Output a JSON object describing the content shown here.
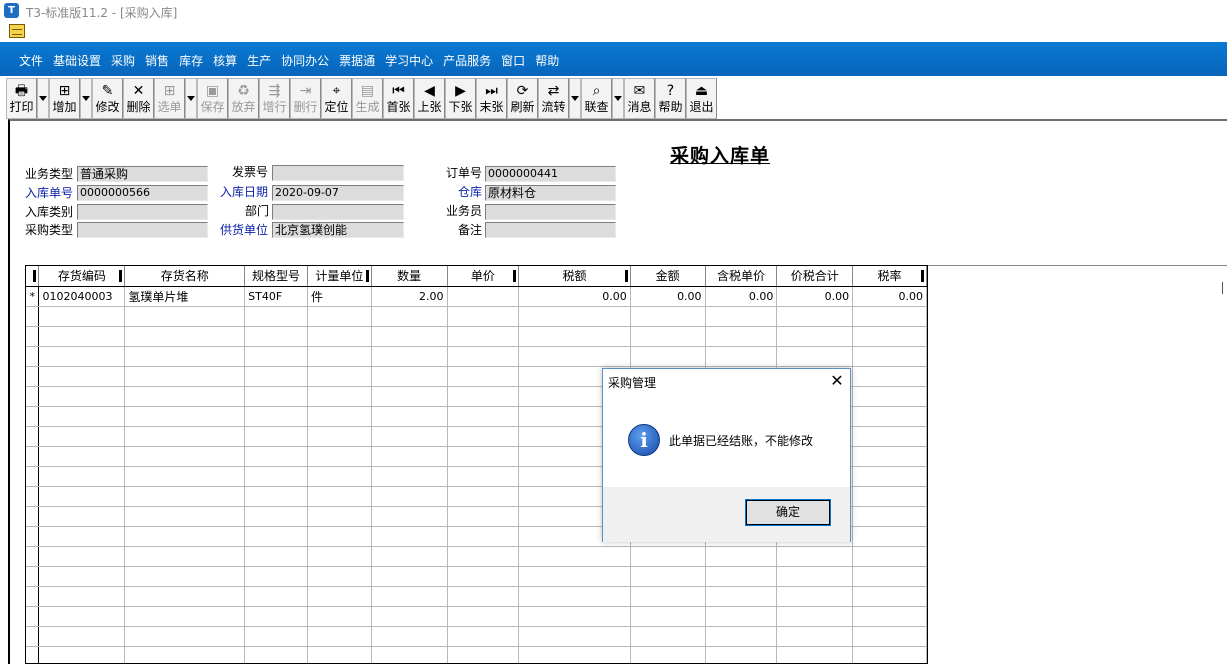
{
  "window": {
    "title": "T3-标准版11.2 - [采购入库]"
  },
  "menu": [
    "文件",
    "基础设置",
    "采购",
    "销售",
    "库存",
    "核算",
    "生产",
    "协同办公",
    "票据通",
    "学习中心",
    "产品服务",
    "窗口",
    "帮助"
  ],
  "toolbar": [
    {
      "label": "打印",
      "icon": "print-icon",
      "glyph": "🖶",
      "enabled": true,
      "dropdown": true
    },
    {
      "label": "增加",
      "icon": "add-icon",
      "glyph": "⊞",
      "enabled": true,
      "dropdown": true
    },
    {
      "label": "修改",
      "icon": "edit-icon",
      "glyph": "✎",
      "enabled": true,
      "dropdown": false
    },
    {
      "label": "删除",
      "icon": "delete-icon",
      "glyph": "✕",
      "enabled": true,
      "dropdown": false
    },
    {
      "label": "选单",
      "icon": "select-doc-icon",
      "glyph": "⊞",
      "enabled": false,
      "dropdown": true
    },
    {
      "label": "保存",
      "icon": "save-icon",
      "glyph": "▣",
      "enabled": false,
      "dropdown": false
    },
    {
      "label": "放弃",
      "icon": "discard-icon",
      "glyph": "♻",
      "enabled": false,
      "dropdown": false
    },
    {
      "label": "增行",
      "icon": "add-row-icon",
      "glyph": "⇶",
      "enabled": false,
      "dropdown": false
    },
    {
      "label": "删行",
      "icon": "delete-row-icon",
      "glyph": "⇥",
      "enabled": false,
      "dropdown": false
    },
    {
      "label": "定位",
      "icon": "locate-icon",
      "glyph": "⌖",
      "enabled": true,
      "dropdown": false
    },
    {
      "label": "生成",
      "icon": "generate-icon",
      "glyph": "▤",
      "enabled": false,
      "dropdown": false
    },
    {
      "label": "首张",
      "icon": "first-record-icon",
      "glyph": "⏮",
      "enabled": true,
      "dropdown": false
    },
    {
      "label": "上张",
      "icon": "previous-record-icon",
      "glyph": "◀",
      "enabled": true,
      "dropdown": false
    },
    {
      "label": "下张",
      "icon": "next-record-icon",
      "glyph": "▶",
      "enabled": true,
      "dropdown": false
    },
    {
      "label": "末张",
      "icon": "last-record-icon",
      "glyph": "⏭",
      "enabled": true,
      "dropdown": false
    },
    {
      "label": "刷新",
      "icon": "refresh-icon",
      "glyph": "⟳",
      "enabled": true,
      "dropdown": false
    },
    {
      "label": "流转",
      "icon": "flow-icon",
      "glyph": "⇄",
      "enabled": true,
      "dropdown": true
    },
    {
      "label": "联查",
      "icon": "linked-query-icon",
      "glyph": "⌕",
      "enabled": true,
      "dropdown": true
    },
    {
      "label": "消息",
      "icon": "message-icon",
      "glyph": "✉",
      "enabled": true,
      "dropdown": false
    },
    {
      "label": "帮助",
      "icon": "help-icon",
      "glyph": "?",
      "enabled": true,
      "dropdown": false
    },
    {
      "label": "退出",
      "icon": "exit-icon",
      "glyph": "⏏",
      "enabled": true,
      "dropdown": false
    }
  ],
  "form": {
    "title": "采购入库单",
    "fields": {
      "business_type": {
        "label": "业务类型",
        "value": "普通采购"
      },
      "receipt_no": {
        "label": "入库单号",
        "value": "0000000566"
      },
      "receipt_category": {
        "label": "入库类别",
        "value": ""
      },
      "purchase_type": {
        "label": "采购类型",
        "value": ""
      },
      "invoice_no": {
        "label": "发票号",
        "value": ""
      },
      "receipt_date": {
        "label": "入库日期",
        "value": "2020-09-07"
      },
      "department": {
        "label": "部门",
        "value": ""
      },
      "supplier": {
        "label": "供货单位",
        "value": "北京氢璞创能"
      },
      "order_no": {
        "label": "订单号",
        "value": "0000000441"
      },
      "warehouse": {
        "label": "仓库",
        "value": "原材料仓"
      },
      "salesperson": {
        "label": "业务员",
        "value": ""
      },
      "remark": {
        "label": "备注",
        "value": ""
      }
    }
  },
  "grid": {
    "columns": [
      "存货编码",
      "存货名称",
      "规格型号",
      "计量单位",
      "数量",
      "单价",
      "税额",
      "金额",
      "含税单价",
      "价税合计",
      "税率"
    ],
    "rows": [
      {
        "marker": "*",
        "cells": [
          "0102040003",
          "氢璞单片堆",
          "ST40F",
          "件",
          "2.00",
          "",
          "0.00",
          "0.00",
          "0.00",
          "0.00",
          "0.00"
        ]
      }
    ]
  },
  "dialog": {
    "title": "采购管理",
    "message": "此单据已经结账，不能修改",
    "ok_label": "确定"
  }
}
